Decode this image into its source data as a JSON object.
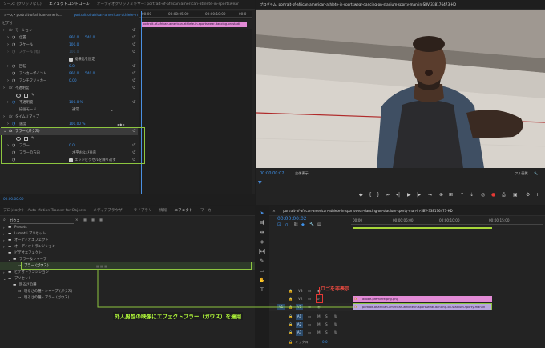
{
  "colors": {
    "accent_blue": "#2d8ceb",
    "highlight_green": "#8dc63f",
    "clip_pink": "#e28bd6",
    "clip_purple": "#b8a7de",
    "annotation_red": "#e53935",
    "annotation_text": "#b5ff3a",
    "playhead": "#4a90e2"
  },
  "effect_controls": {
    "tabs": [
      "ソース: (クリップなし)",
      "エフェクトコントロール",
      "オーディオクリップミキサー: portrait-of-african-american-athlete-in-sportswear"
    ],
    "source_clip": "ソース・portrait-of-african-americ...",
    "target_clip": "portrait-of-african-american-athlete-in-sportswe...",
    "ruler_start": "00:00",
    "ruler_mid1": "00:00:05:00",
    "ruler_mid2": "00:00:10:00",
    "ruler_end": "00:0",
    "mini_clip": "portrait-of-african-american-athlete-in-sportswear-dancing-on-stadi",
    "section_video": "ビデオ",
    "motion": "モーション",
    "position": "位置",
    "position_x": "960.0",
    "position_y": "540.0",
    "scale": "スケール",
    "scale_val": "100.0",
    "scale_width": "スケール (幅)",
    "scale_width_val": "100.0",
    "uniform_scale": "縦横比を固定",
    "rotation": "回転",
    "rotation_val": "0.0",
    "anchor": "アンカーポイント",
    "anchor_x": "960.0",
    "anchor_y": "540.0",
    "antiflicker": "アンチフリッカー",
    "antiflicker_val": "0.00",
    "opacity": "不透明度",
    "opacity_label": "不透明度",
    "opacity_val": "100.0 %",
    "blend_mode": "描画モード",
    "blend_val": "通常",
    "time_remap": "タイムリマップ",
    "speed": "速度",
    "speed_val": "100.00 %",
    "blur": "ブラー (ガウス)",
    "blurriness": "ブラー",
    "blurriness_val": "0.0",
    "blur_dims": "ブラーの方向",
    "blur_dims_val": "水平および垂直",
    "repeat_edge": "エッジピクセルを繰り返す",
    "footer_time": "00:00:00:00"
  },
  "program": {
    "title": "プログラム: portrait-of-african-american-athlete-in-sportswear-dancing-on-stadium-sporty-man-in-SBV-338176473-HD",
    "timecode": "00:00:00:02",
    "fit": "全体表示",
    "quality": "フル画質",
    "duration": "00:00:17:19"
  },
  "project": {
    "tabs": [
      "プロジェクト: Auto Motion Tracker for Objects",
      "メディアブラウザー",
      "ライブラリ",
      "情報",
      "エフェクト",
      "マーカー"
    ],
    "search_value": "ガウス",
    "tree": [
      {
        "label": "Presets",
        "indent": 0
      },
      {
        "label": "Lumetri プリセット",
        "indent": 0
      },
      {
        "label": "オーディオエフェクト",
        "indent": 0
      },
      {
        "label": "オーディオトランジション",
        "indent": 0
      },
      {
        "label": "ビデオエフェクト",
        "indent": 0
      },
      {
        "label": "ブラー＆シャープ",
        "indent": 1
      },
      {
        "label": "ブラー (ガウス)",
        "indent": 2
      },
      {
        "label": "ビデオトランジション",
        "indent": 0
      },
      {
        "label": "プリセット",
        "indent": 0
      },
      {
        "label": "明るさの種",
        "indent": 1
      },
      {
        "label": "明るさの種 - シャープ (ガウス)",
        "indent": 2
      },
      {
        "label": "明るさの種 - ブラー (ガウス)",
        "indent": 2
      }
    ]
  },
  "timeline": {
    "title": "portrait-of-african-american-athlete-in-sportswear-dancing-on-stadium-sporty-man-in-SBV-338176473-HD",
    "timecode": "00:00:00:02",
    "ruler": [
      "00:00",
      "00:00:05:00",
      "00:00:10:00",
      "00:00:15:00"
    ],
    "tracks_video": [
      "V3",
      "V2",
      "V1"
    ],
    "tracks_audio": [
      "A1",
      "A2",
      "A3"
    ],
    "mix": "ミックス",
    "mix_val": "0.0",
    "clip_v2": "adobe-premiere-png.png",
    "clip_v1": "portrait-of-african-american-athlete-in-sportswear-dancing-on-stadium-sporty-man-in"
  },
  "annotations": {
    "logo_hide": "ロゴを非表示",
    "apply_effect": "外人男性の映像にエフェクトブラー（ガウス）を適用"
  }
}
